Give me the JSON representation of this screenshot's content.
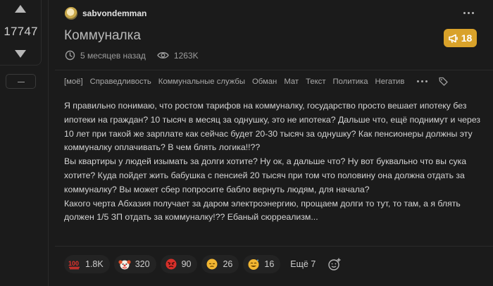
{
  "vote": {
    "rating": "17747"
  },
  "author": {
    "name": "sabvondemman"
  },
  "post": {
    "title": "Коммуналка",
    "comments_count": "18",
    "age": "5 месяцев назад",
    "views": "1263K"
  },
  "tags": [
    "[моё]",
    "Справедливость",
    "Коммунальные службы",
    "Обман",
    "Мат",
    "Текст",
    "Политика",
    "Негатив"
  ],
  "body": {
    "p1": "Я правильно понимаю, что ростом тарифов на коммуналку, государство просто вешает ипотеку без ипотеки на граждан? 10 тысяч в месяц за однушку, это не ипотека? Дальше что, ещё поднимут и через 10 лет при такой же зарплате как сейчас будет 20-30 тысяч за однушку? Как пенсионеры должны эту коммуналку оплачивать? В чем блять логика!!??",
    "p2": "Вы квартиры у людей изымать за долги хотите? Ну ок, а дальше что? Ну вот буквально что вы сука хотите? Куда пойдет жить бабушка с пенсией 20 тысяч при том что половину она должна отдать за коммуналку? Вы может сбер попросите бабло вернуть людям, для начала?",
    "p3": "Какого черта Абхазия получает за даром электроэнергию, прощаем долги то тут, то там, а я блять должен 1/5 ЗП отдать за коммуналку!?? Ебаный сюрреализм..."
  },
  "reactions": [
    {
      "icon": "hundred-points-icon",
      "count": "1.8K"
    },
    {
      "icon": "clown-face-icon",
      "count": "320"
    },
    {
      "icon": "angry-face-icon",
      "count": "90"
    },
    {
      "icon": "pensive-face-icon",
      "count": "26"
    },
    {
      "icon": "sweat-smile-face-icon",
      "count": "16"
    }
  ],
  "reactions_more": "Ещё 7",
  "colors": {
    "badge": "#d9a22a",
    "background": "#1b1b1b"
  }
}
